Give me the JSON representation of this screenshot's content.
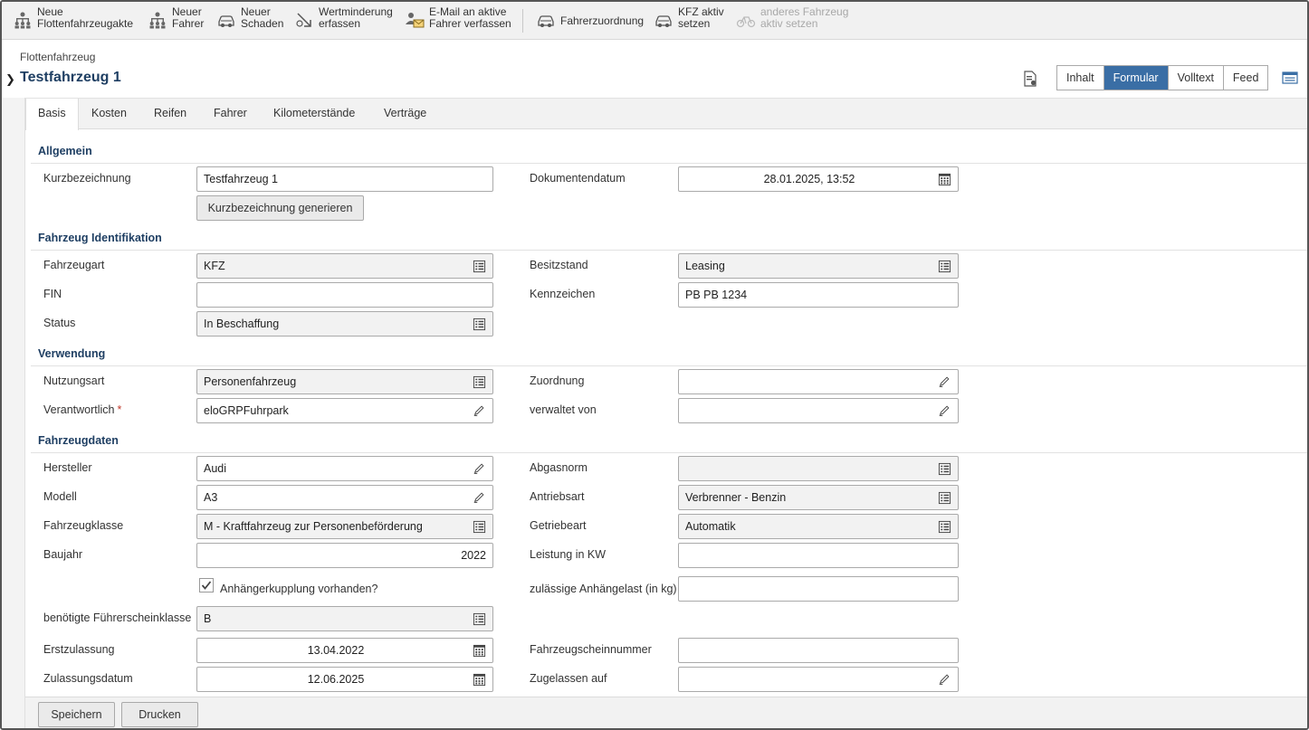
{
  "toolbar": {
    "items": [
      {
        "line1": "Neue",
        "line2": "Flottenfahrzeugakte",
        "icon": "new-fleet-file-icon",
        "enabled": true
      },
      {
        "line1": "Neuer",
        "line2": "Fahrer",
        "icon": "new-driver-icon",
        "enabled": true
      },
      {
        "line1": "Neuer",
        "line2": "Schaden",
        "icon": "new-damage-car-icon",
        "enabled": true
      },
      {
        "line1": "Wertminderung",
        "line2": "erfassen",
        "icon": "depreciation-icon",
        "enabled": true
      },
      {
        "line1": "E-Mail an aktive",
        "line2": "Fahrer verfassen",
        "icon": "email-drivers-icon",
        "enabled": true
      },
      {
        "line1": "Fahrerzuordnung",
        "line2": "",
        "icon": "driver-assignment-icon",
        "enabled": true
      },
      {
        "line1": "KFZ aktiv",
        "line2": "setzen",
        "icon": "set-car-active-icon",
        "enabled": true
      },
      {
        "line1": "anderes Fahrzeug",
        "line2": "aktiv setzen",
        "icon": "set-other-vehicle-active-icon",
        "enabled": false
      }
    ]
  },
  "header": {
    "breadcrumb": "Flottenfahrzeug",
    "title": "Testfahrzeug 1",
    "view_tabs": [
      "Inhalt",
      "Formular",
      "Volltext",
      "Feed"
    ],
    "active_view": "Formular"
  },
  "tabs": [
    "Basis",
    "Kosten",
    "Reifen",
    "Fahrer",
    "Kilometerstände",
    "Verträge"
  ],
  "active_tab": "Basis",
  "sections": {
    "allgemein": "Allgemein",
    "identifikation": "Fahrzeug Identifikation",
    "verwendung": "Verwendung",
    "fahrzeugdaten": "Fahrzeugdaten"
  },
  "fields": {
    "kurzbezeichnung": {
      "label": "Kurzbezeichnung",
      "value": "Testfahrzeug 1"
    },
    "generate_button": "Kurzbezeichnung generieren",
    "dokumentendatum": {
      "label": "Dokumentendatum",
      "value": "28.01.2025, 13:52"
    },
    "fahrzeugart": {
      "label": "Fahrzeugart",
      "value": "KFZ"
    },
    "besitzstand": {
      "label": "Besitzstand",
      "value": "Leasing"
    },
    "fin": {
      "label": "FIN",
      "value": ""
    },
    "kennzeichen": {
      "label": "Kennzeichen",
      "value": "PB PB 1234"
    },
    "status": {
      "label": "Status",
      "value": "In Beschaffung"
    },
    "nutzungsart": {
      "label": "Nutzungsart",
      "value": "Personenfahrzeug"
    },
    "zuordnung": {
      "label": "Zuordnung",
      "value": ""
    },
    "verantwortlich": {
      "label": "Verantwortlich",
      "value": "eloGRPFuhrpark",
      "required_mark": "*"
    },
    "verwaltet_von": {
      "label": "verwaltet von",
      "value": ""
    },
    "hersteller": {
      "label": "Hersteller",
      "value": "Audi"
    },
    "abgasnorm": {
      "label": "Abgasnorm",
      "value": ""
    },
    "modell": {
      "label": "Modell",
      "value": "A3"
    },
    "antriebsart": {
      "label": "Antriebsart",
      "value": "Verbrenner - Benzin"
    },
    "fahrzeugklasse": {
      "label": "Fahrzeugklasse",
      "value": "M - Kraftfahrzeug zur Personenbeförderung"
    },
    "getriebeart": {
      "label": "Getriebeart",
      "value": "Automatik"
    },
    "baujahr": {
      "label": "Baujahr",
      "value": "2022"
    },
    "leistung": {
      "label": "Leistung in KW",
      "value": ""
    },
    "anhaengerkupplung": {
      "label": "Anhängerkupplung vorhanden?",
      "checked": true
    },
    "anhaengelast": {
      "label": "zulässige Anhängelast (in kg)",
      "value": ""
    },
    "fuehrerscheinklasse": {
      "label": "benötigte Führerscheinklasse",
      "value": "B"
    },
    "erstzulassung": {
      "label": "Erstzulassung",
      "value": "13.04.2022"
    },
    "fahrzeugscheinnummer": {
      "label": "Fahrzeugscheinnummer",
      "value": ""
    },
    "zulassungsdatum": {
      "label": "Zulassungsdatum",
      "value": "12.06.2025"
    },
    "zugelassen_auf": {
      "label": "Zugelassen auf",
      "value": ""
    }
  },
  "footer": {
    "save": "Speichern",
    "print": "Drucken"
  },
  "colors": {
    "accent": "#3a6ea5",
    "title": "#1f3f63",
    "required": "#c0392b"
  }
}
